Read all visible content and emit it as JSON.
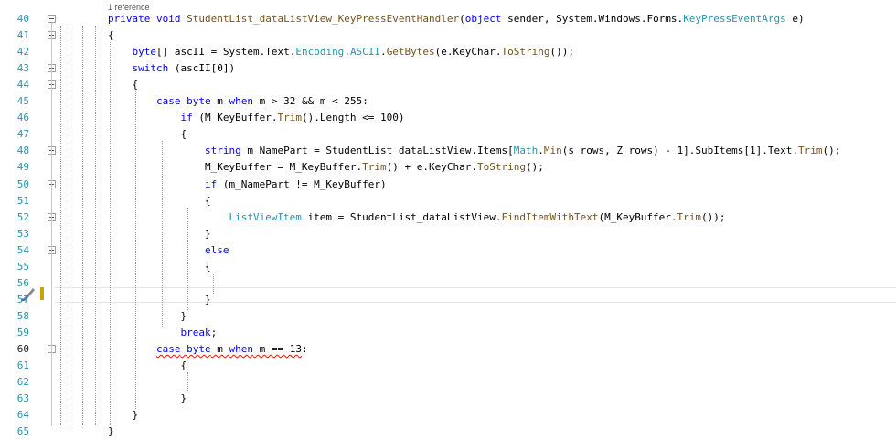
{
  "codelens": {
    "references": "1 reference"
  },
  "lines": [
    {
      "n": "40",
      "tokens": [
        [
          "kw",
          "private"
        ],
        [
          "t",
          " "
        ],
        [
          "kw",
          "void"
        ],
        [
          "t",
          " "
        ],
        [
          "me",
          "StudentList_dataListView_KeyPressEventHandler"
        ],
        [
          "t",
          "("
        ],
        [
          "kw",
          "object"
        ],
        [
          "t",
          " sender, System.Windows.Forms."
        ],
        [
          "ty",
          "KeyPressEventArgs"
        ],
        [
          "t",
          " e)"
        ]
      ]
    },
    {
      "n": "41",
      "tokens": [
        [
          "t",
          "{"
        ]
      ]
    },
    {
      "n": "42",
      "tokens": [
        [
          "t",
          "    "
        ],
        [
          "kw",
          "byte"
        ],
        [
          "t",
          "[] ascII = System.Text."
        ],
        [
          "ty",
          "Encoding"
        ],
        [
          "t",
          "."
        ],
        [
          "ty",
          "ASCII"
        ],
        [
          "t",
          "."
        ],
        [
          "me",
          "GetBytes"
        ],
        [
          "t",
          "(e.KeyChar."
        ],
        [
          "me",
          "ToString"
        ],
        [
          "t",
          "());"
        ]
      ]
    },
    {
      "n": "43",
      "tokens": [
        [
          "t",
          "    "
        ],
        [
          "kw",
          "switch"
        ],
        [
          "t",
          " (ascII[0])"
        ]
      ]
    },
    {
      "n": "44",
      "tokens": [
        [
          "t",
          "    {"
        ]
      ]
    },
    {
      "n": "45",
      "tokens": [
        [
          "t",
          "        "
        ],
        [
          "kw",
          "case"
        ],
        [
          "t",
          " "
        ],
        [
          "kw",
          "byte"
        ],
        [
          "t",
          " m "
        ],
        [
          "kw",
          "when"
        ],
        [
          "t",
          " m > 32 && m < 255:"
        ]
      ]
    },
    {
      "n": "46",
      "tokens": [
        [
          "t",
          "            "
        ],
        [
          "kw",
          "if"
        ],
        [
          "t",
          " (M_KeyBuffer."
        ],
        [
          "me",
          "Trim"
        ],
        [
          "t",
          "().Length <= 100)"
        ]
      ]
    },
    {
      "n": "47",
      "tokens": [
        [
          "t",
          "            {"
        ]
      ]
    },
    {
      "n": "48",
      "tokens": [
        [
          "t",
          "                "
        ],
        [
          "kw",
          "string"
        ],
        [
          "t",
          " m_NamePart = StudentList_dataListView.Items["
        ],
        [
          "ty",
          "Math"
        ],
        [
          "t",
          "."
        ],
        [
          "me",
          "Min"
        ],
        [
          "t",
          "(s_rows, Z_rows) - 1].SubItems[1].Text."
        ],
        [
          "me",
          "Trim"
        ],
        [
          "t",
          "();"
        ]
      ]
    },
    {
      "n": "49",
      "tokens": [
        [
          "t",
          "                M_KeyBuffer = M_KeyBuffer."
        ],
        [
          "me",
          "Trim"
        ],
        [
          "t",
          "() + e.KeyChar."
        ],
        [
          "me",
          "ToString"
        ],
        [
          "t",
          "();"
        ]
      ]
    },
    {
      "n": "50",
      "tokens": [
        [
          "t",
          "                "
        ],
        [
          "kw",
          "if"
        ],
        [
          "t",
          " (m_NamePart != M_KeyBuffer)"
        ]
      ]
    },
    {
      "n": "51",
      "tokens": [
        [
          "t",
          "                {"
        ]
      ]
    },
    {
      "n": "52",
      "tokens": [
        [
          "t",
          "                    "
        ],
        [
          "ty",
          "ListViewItem"
        ],
        [
          "t",
          " item = StudentList_dataListView."
        ],
        [
          "me",
          "FindItemWithText"
        ],
        [
          "t",
          "(M_KeyBuffer."
        ],
        [
          "me",
          "Trim"
        ],
        [
          "t",
          "());"
        ]
      ]
    },
    {
      "n": "53",
      "tokens": [
        [
          "t",
          "                }"
        ]
      ]
    },
    {
      "n": "54",
      "tokens": [
        [
          "t",
          "                "
        ],
        [
          "kw",
          "else"
        ]
      ]
    },
    {
      "n": "55",
      "tokens": [
        [
          "t",
          "                {"
        ]
      ]
    },
    {
      "n": "56",
      "tokens": [
        [
          "t",
          ""
        ]
      ]
    },
    {
      "n": "57",
      "tokens": [
        [
          "t",
          "                }"
        ]
      ]
    },
    {
      "n": "58",
      "tokens": [
        [
          "t",
          "            }"
        ]
      ]
    },
    {
      "n": "59",
      "tokens": [
        [
          "t",
          "            "
        ],
        [
          "kw",
          "break"
        ],
        [
          "t",
          ";"
        ]
      ]
    },
    {
      "n": "60",
      "current": true,
      "tokens": [
        [
          "t",
          "        "
        ],
        [
          "sqkw",
          "case"
        ],
        [
          "sq",
          " "
        ],
        [
          "sqkw",
          "byte"
        ],
        [
          "sq",
          " m "
        ],
        [
          "sqkw",
          "when"
        ],
        [
          "sq",
          " m == 13"
        ],
        [
          "t",
          ":"
        ]
      ]
    },
    {
      "n": "61",
      "tokens": [
        [
          "t",
          "            {"
        ]
      ]
    },
    {
      "n": "62",
      "tokens": [
        [
          "t",
          ""
        ]
      ]
    },
    {
      "n": "63",
      "tokens": [
        [
          "t",
          "            }"
        ]
      ]
    },
    {
      "n": "64",
      "tokens": [
        [
          "t",
          "    }"
        ]
      ]
    },
    {
      "n": "65",
      "tokens": [
        [
          "t",
          "}"
        ]
      ]
    }
  ],
  "folds": [
    "40",
    "41",
    "43",
    "44",
    "48",
    "50",
    "52",
    "54",
    "60"
  ],
  "colors": {
    "keyword": "#0000ff",
    "type": "#2b91af",
    "method": "#74531f",
    "linenum": "#2b91af",
    "squiggle": "#e51400",
    "changebar": "#c8a400"
  },
  "icons": {
    "quick_action": "paintbrush-icon",
    "fold": "collapse-minus-icon"
  }
}
